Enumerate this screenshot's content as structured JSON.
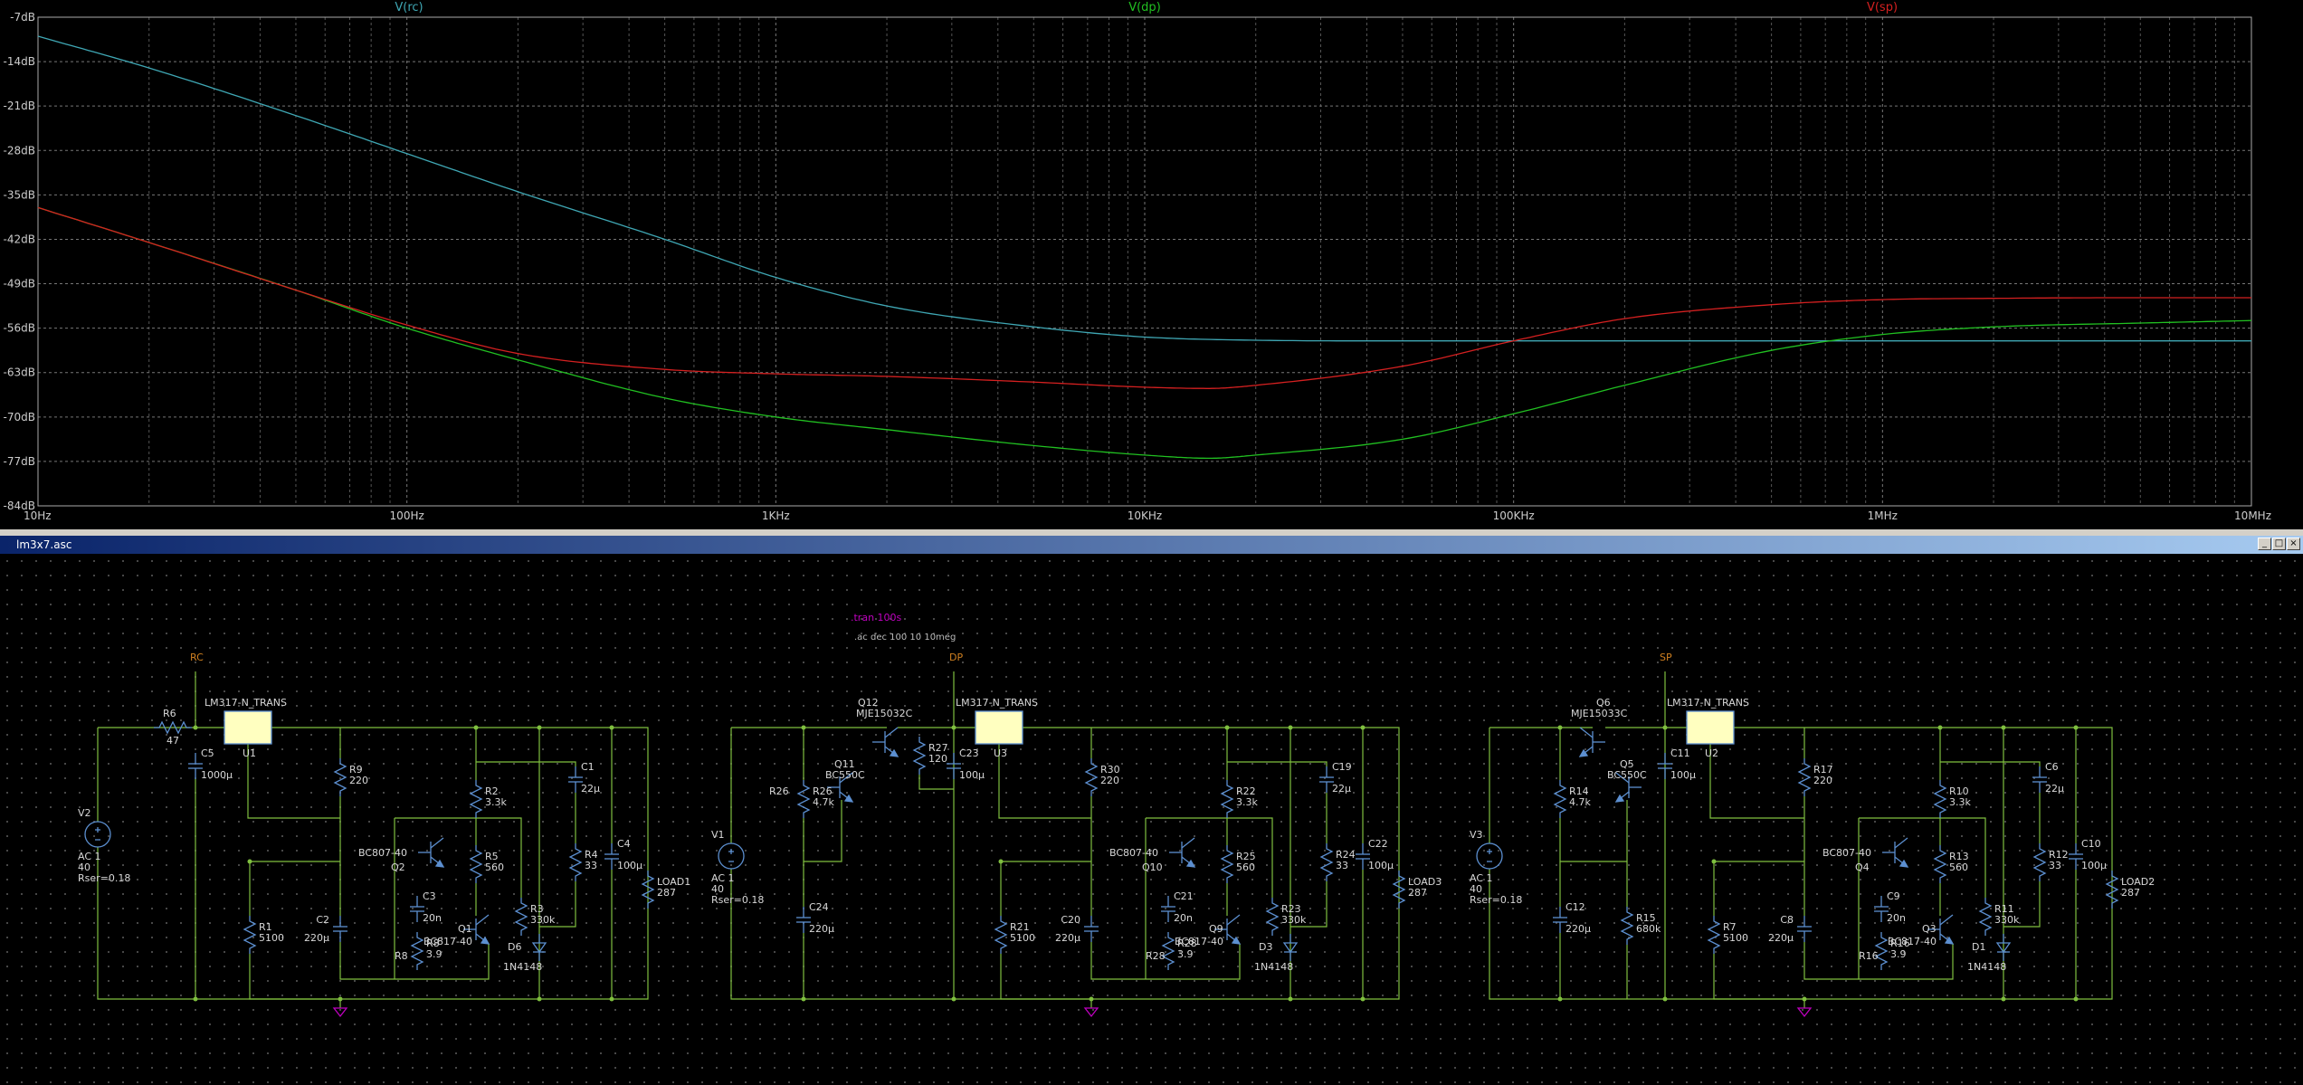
{
  "chart_data": {
    "type": "line",
    "x_scale": "log",
    "xlim_hz": [
      10,
      10000000
    ],
    "ylim_db": [
      -84,
      -7
    ],
    "grid": true,
    "x_ticks": [
      {
        "value": 10,
        "label": "10Hz"
      },
      {
        "value": 100,
        "label": "100Hz"
      },
      {
        "value": 1000,
        "label": "1KHz"
      },
      {
        "value": 10000,
        "label": "10KHz"
      },
      {
        "value": 100000,
        "label": "100KHz"
      },
      {
        "value": 1000000,
        "label": "1MHz"
      },
      {
        "value": 10000000,
        "label": "10MHz"
      }
    ],
    "y_ticks": [
      {
        "value": -7,
        "label": "-7dB"
      },
      {
        "value": -14,
        "label": "-14dB"
      },
      {
        "value": -21,
        "label": "-21dB"
      },
      {
        "value": -28,
        "label": "-28dB"
      },
      {
        "value": -35,
        "label": "-35dB"
      },
      {
        "value": -42,
        "label": "-42dB"
      },
      {
        "value": -49,
        "label": "-49dB"
      },
      {
        "value": -56,
        "label": "-56dB"
      },
      {
        "value": -63,
        "label": "-63dB"
      },
      {
        "value": -70,
        "label": "-70dB"
      },
      {
        "value": -77,
        "label": "-77dB"
      },
      {
        "value": -84,
        "label": "-84dB"
      }
    ],
    "series": [
      {
        "name": "V(rc)",
        "color": "#3fa7b4",
        "x": [
          10,
          20,
          50,
          100,
          200,
          500,
          1000,
          2000,
          5000,
          10000,
          20000,
          50000,
          100000,
          1000000,
          10000000
        ],
        "y": [
          -10,
          -15,
          -22.5,
          -28.5,
          -34.5,
          -42,
          -48,
          -52.5,
          -55.8,
          -57.4,
          -57.9,
          -58,
          -58,
          -58,
          -58
        ]
      },
      {
        "name": "V(dp)",
        "color": "#21c021",
        "x": [
          10,
          20,
          50,
          100,
          200,
          500,
          1000,
          2000,
          5000,
          10000,
          15000,
          20000,
          50000,
          100000,
          200000,
          500000,
          1000000,
          2000000,
          5000000,
          10000000
        ],
        "y": [
          -37,
          -42.5,
          -50,
          -56,
          -61,
          -67,
          -70,
          -72,
          -74.5,
          -76,
          -76.5,
          -76,
          -73.5,
          -69.5,
          -65,
          -59.5,
          -57,
          -55.8,
          -55.2,
          -54.8
        ]
      },
      {
        "name": "V(sp)",
        "color": "#d42020",
        "x": [
          10,
          20,
          50,
          100,
          200,
          500,
          1000,
          2000,
          5000,
          10000,
          15000,
          20000,
          50000,
          100000,
          200000,
          500000,
          1000000,
          2000000,
          5000000,
          10000000
        ],
        "y": [
          -37,
          -42.5,
          -50,
          -55.5,
          -60,
          -62.5,
          -63.2,
          -63.6,
          -64.5,
          -65.3,
          -65.5,
          -65,
          -62,
          -58,
          -54.5,
          -52.3,
          -51.5,
          -51.3,
          -51.2,
          -51.2
        ]
      }
    ]
  },
  "window": {
    "title": "lm3x7.asc",
    "minimize_glyph": "_",
    "restore_glyph": "□",
    "close_glyph": "×"
  },
  "schematic": {
    "directives": {
      "tran": ".tran 100s",
      "ac": ".ac dec 100 10 10meg"
    },
    "net_labels": {
      "rc": "RC",
      "dp": "DP",
      "sp": "SP"
    },
    "regulators": {
      "u1": {
        "name": "U1",
        "value": "LM317-N_TRANS"
      },
      "u3": {
        "name": "U3",
        "value": "LM317-N_TRANS"
      },
      "u2": {
        "name": "U2",
        "value": "LM317-N_TRANS"
      }
    },
    "sources": {
      "v2": {
        "name": "V2",
        "l1": "AC 1",
        "l2": "40",
        "l3": "Rser=0.18"
      },
      "v1": {
        "name": "V1",
        "l1": "AC 1",
        "l2": "40",
        "l3": "Rser=0.18"
      },
      "v3": {
        "name": "V3",
        "l1": "AC 1",
        "l2": "40",
        "l3": "Rser=0.18"
      }
    },
    "parts": {
      "r6": {
        "name": "R6",
        "value": "47"
      },
      "c5": {
        "name": "C5",
        "value": "1000µ"
      },
      "r9": {
        "name": "R9",
        "value": "220"
      },
      "r1": {
        "name": "R1",
        "value": "5100"
      },
      "c2": {
        "name": "C2",
        "value": "220µ"
      },
      "q2": {
        "name": "Q2",
        "value": "BC807-40"
      },
      "c3": {
        "name": "C3",
        "value": "20n"
      },
      "r8": {
        "name": "R8",
        "value": "3.9"
      },
      "q1": {
        "name": "Q1",
        "value": "BC817-40"
      },
      "r2": {
        "name": "R2",
        "value": "3.3k"
      },
      "r5": {
        "name": "R5",
        "value": "560"
      },
      "r3": {
        "name": "R3",
        "value": "330k"
      },
      "d6": {
        "name": "D6",
        "value": "1N4148"
      },
      "c1": {
        "name": "C1",
        "value": "22µ"
      },
      "r4": {
        "name": "R4",
        "value": "33"
      },
      "c4": {
        "name": "C4",
        "value": "100µ"
      },
      "load1": {
        "name": "LOAD1",
        "value": "287"
      },
      "q12": {
        "name": "Q12",
        "value": "MJE15032C"
      },
      "q11": {
        "name": "Q11",
        "value": "BC550C"
      },
      "r26": {
        "name": "R26",
        "value": "4.7k"
      },
      "c24": {
        "name": "C24",
        "value": "220µ"
      },
      "r27": {
        "name": "R27",
        "value": "120"
      },
      "c23": {
        "name": "C23",
        "value": "100µ"
      },
      "r30": {
        "name": "R30",
        "value": "220"
      },
      "r21": {
        "name": "R21",
        "value": "5100"
      },
      "c20": {
        "name": "C20",
        "value": "220µ"
      },
      "q10": {
        "name": "Q10",
        "value": "BC807-40"
      },
      "c21": {
        "name": "C21",
        "value": "20n"
      },
      "r28": {
        "name": "R28",
        "value": "3.9"
      },
      "q9": {
        "name": "Q9",
        "value": "BC817-40"
      },
      "r22": {
        "name": "R22",
        "value": "3.3k"
      },
      "r25": {
        "name": "R25",
        "value": "560"
      },
      "r23": {
        "name": "R23",
        "value": "330k"
      },
      "d3": {
        "name": "D3",
        "value": "1N4148"
      },
      "c19": {
        "name": "C19",
        "value": "22µ"
      },
      "r24": {
        "name": "R24",
        "value": "33"
      },
      "c22": {
        "name": "C22",
        "value": "100µ"
      },
      "load3": {
        "name": "LOAD3",
        "value": "287"
      },
      "q6": {
        "name": "Q6",
        "value": "MJE15033C"
      },
      "q5": {
        "name": "Q5",
        "value": "BC550C"
      },
      "r14": {
        "name": "R14",
        "value": "4.7k"
      },
      "c12": {
        "name": "C12",
        "value": "220µ"
      },
      "r15": {
        "name": "R15",
        "value": "680k"
      },
      "c11": {
        "name": "C11",
        "value": "100µ"
      },
      "r17": {
        "name": "R17",
        "value": "220"
      },
      "r7": {
        "name": "R7",
        "value": "5100"
      },
      "c8": {
        "name": "C8",
        "value": "220µ"
      },
      "q4": {
        "name": "Q4",
        "value": "BC807-40"
      },
      "c9": {
        "name": "C9",
        "value": "20n"
      },
      "r16": {
        "name": "R16",
        "value": "3.9"
      },
      "q3": {
        "name": "Q3",
        "value": "BC817-40"
      },
      "r10": {
        "name": "R10",
        "value": "3.3k"
      },
      "r13": {
        "name": "R13",
        "value": "560"
      },
      "r11": {
        "name": "R11",
        "value": "330k"
      },
      "d1": {
        "name": "D1",
        "value": "1N4148"
      },
      "c6": {
        "name": "C6",
        "value": "22µ"
      },
      "r12": {
        "name": "R12",
        "value": "33"
      },
      "c10": {
        "name": "C10",
        "value": "100µ"
      },
      "load2": {
        "name": "LOAD2",
        "value": "287"
      }
    },
    "colors": {
      "wire": "#7fbf3f",
      "component": "#5c8fd0",
      "label": "#d8d8d8",
      "directive": "#c000c0",
      "net_label": "#d08020",
      "regulator_fill": "#ffffc0"
    }
  }
}
